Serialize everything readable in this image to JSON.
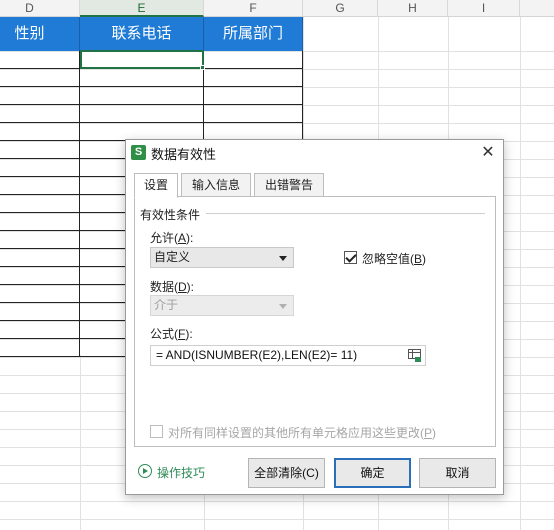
{
  "spreadsheet": {
    "columns": [
      {
        "letter": "D",
        "active": false
      },
      {
        "letter": "E",
        "active": true
      },
      {
        "letter": "F",
        "active": false
      },
      {
        "letter": "G",
        "active": false
      },
      {
        "letter": "H",
        "active": false
      },
      {
        "letter": "I",
        "active": false
      }
    ],
    "table_headers": [
      "性别",
      "联系电话",
      "所属部门"
    ],
    "header_color": "#1f7bd6",
    "selection_color": "#217346"
  },
  "dialog": {
    "title": "数据有效性",
    "app_icon_letter": "S",
    "close_glyph": "✕",
    "tabs": [
      {
        "label": "设置",
        "active": true
      },
      {
        "label": "输入信息",
        "active": false
      },
      {
        "label": "出错警告",
        "active": false
      }
    ],
    "group_label": "有效性条件",
    "allow": {
      "label_prefix": "允许(",
      "hotkey": "A",
      "label_suffix": "):",
      "value": "自定义"
    },
    "ignore_blank": {
      "label_prefix": "忽略空值(",
      "hotkey": "B",
      "label_suffix": ")",
      "checked": true
    },
    "data": {
      "label_prefix": "数据(",
      "hotkey": "D",
      "label_suffix": "):",
      "value": "介于",
      "disabled": true
    },
    "formula": {
      "label_prefix": "公式(",
      "hotkey": "F",
      "label_suffix": "):",
      "value": "= AND(ISNUMBER(E2),LEN(E2)= 11)"
    },
    "apply_all": {
      "label_prefix": "对所有同样设置的其他所有单元格应用这些更改(",
      "hotkey": "P",
      "label_suffix": ")",
      "checked": false,
      "disabled": true
    },
    "tips_label": "操作技巧",
    "buttons": {
      "clear_all": "全部清除(C)",
      "ok": "确定",
      "cancel": "取消"
    }
  }
}
